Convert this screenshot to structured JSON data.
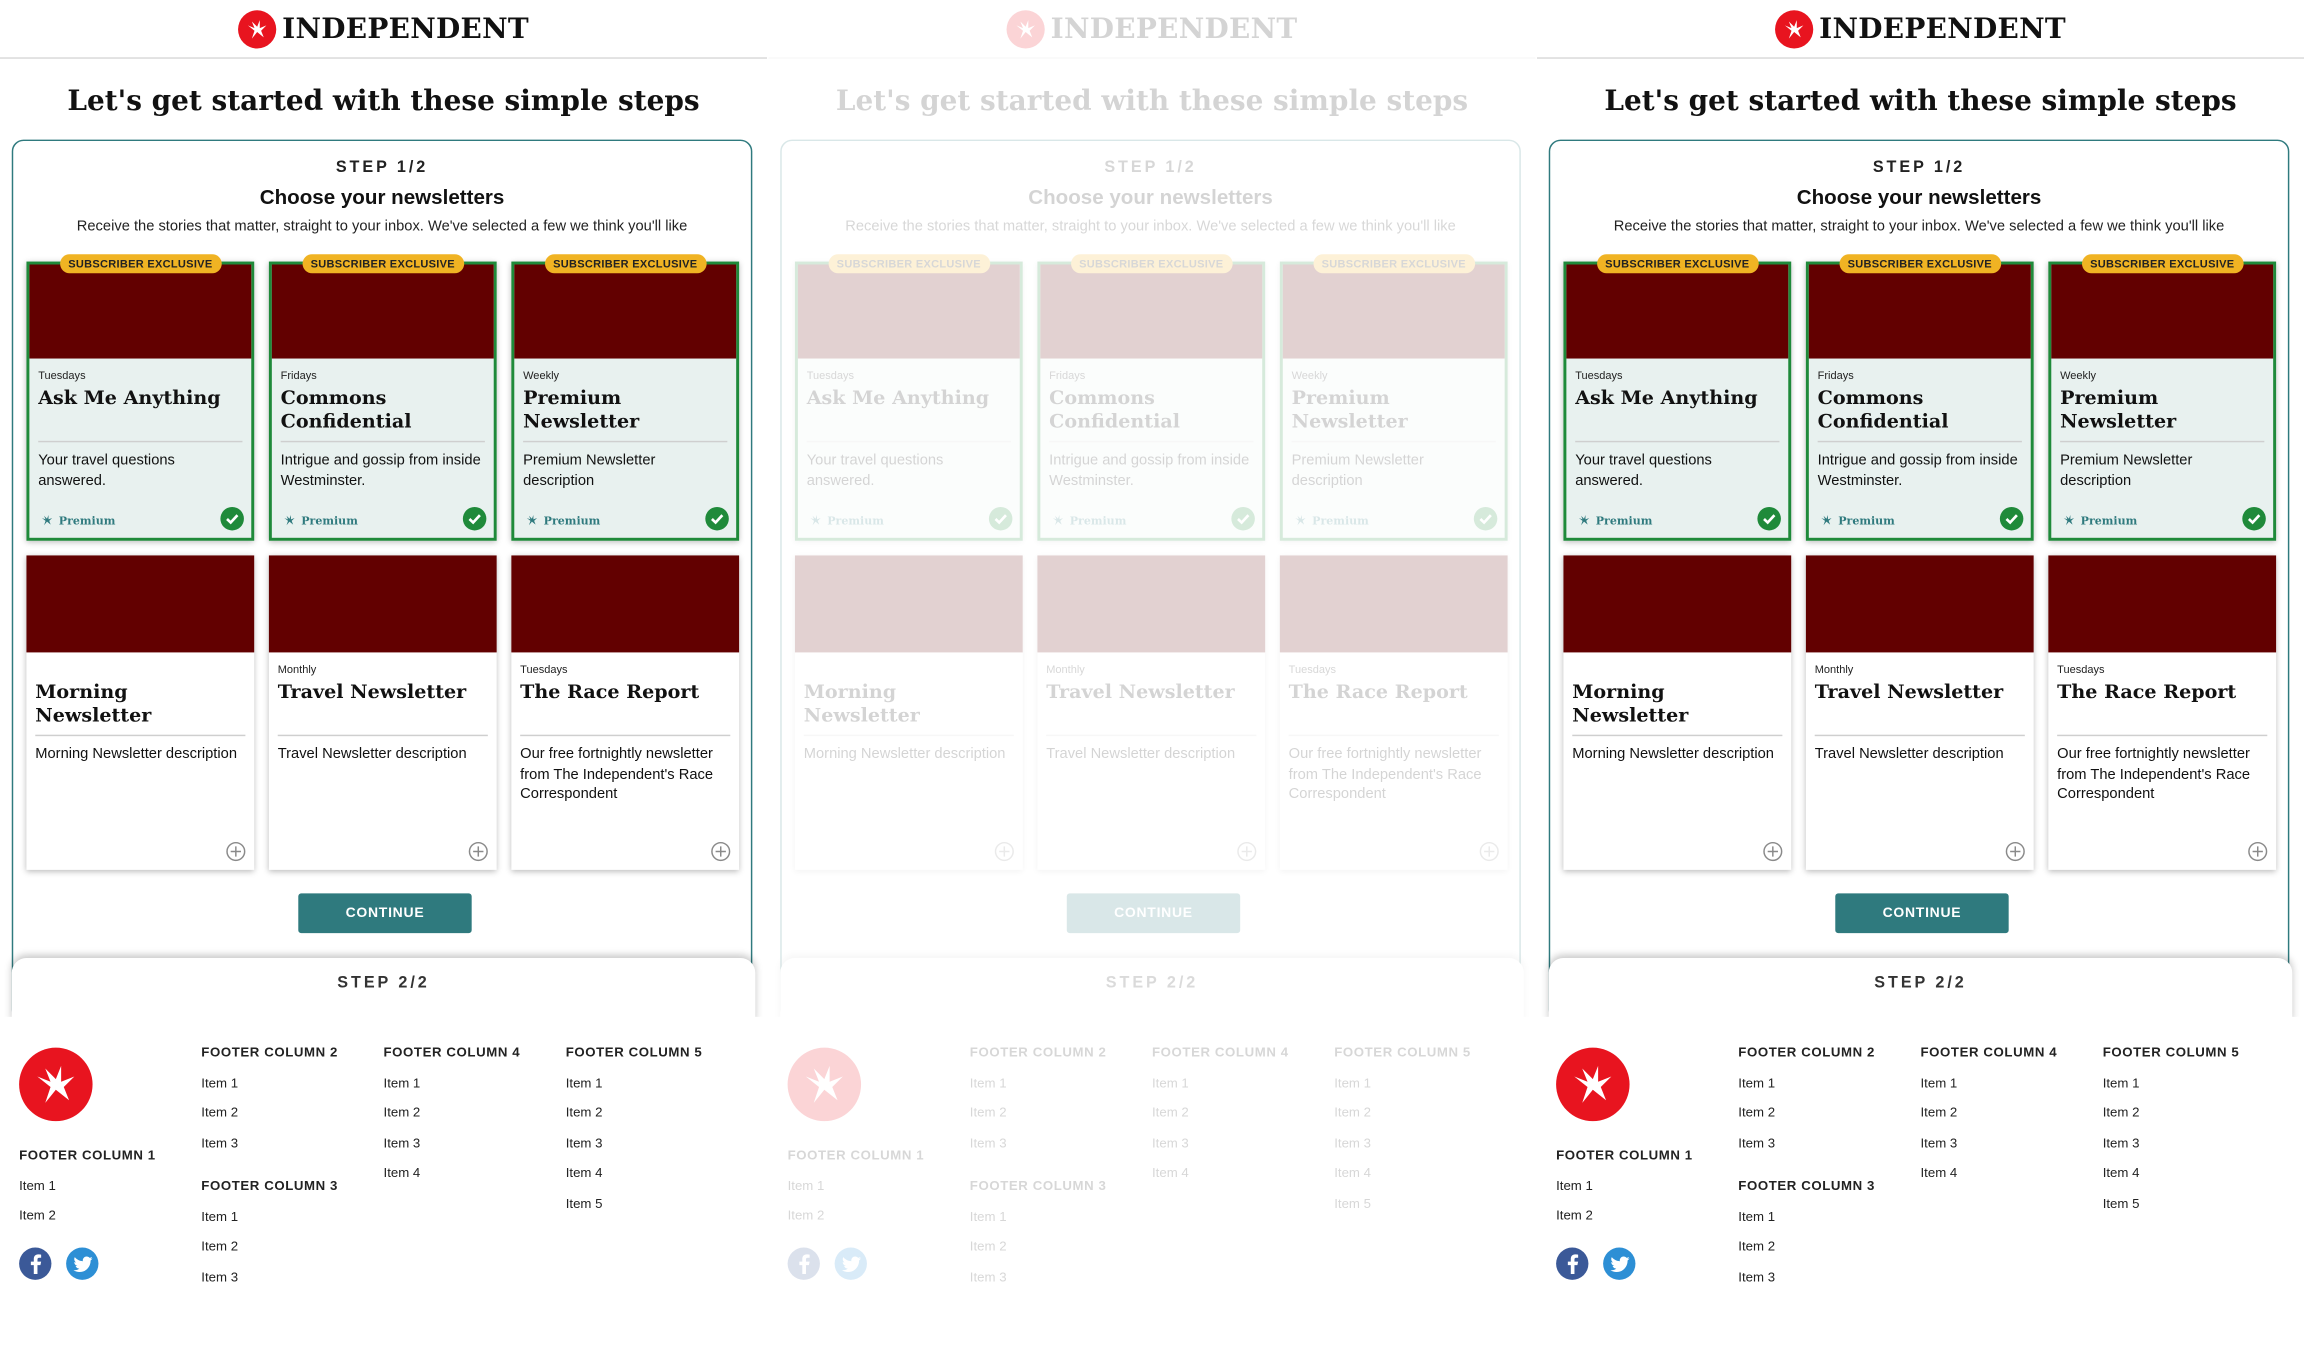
{
  "brand": {
    "name": "INDEPENDENT",
    "logo_icon": "eagle-logo-icon",
    "accent": "#e8141f"
  },
  "page": {
    "title": "Let's get started with these simple steps"
  },
  "step1": {
    "label": "STEP 1/2",
    "heading": "Choose your newsletters",
    "subtitle": "Receive the stories that matter, straight to your inbox. We've selected a few we think you'll like"
  },
  "cards": [
    {
      "badge": "SUBSCRIBER EXCLUSIVE",
      "frequency": "Tuesdays",
      "title": "Ask Me Anything",
      "description": "Your travel questions answered.",
      "premium_label": "Premium",
      "selected": true
    },
    {
      "badge": "SUBSCRIBER EXCLUSIVE",
      "frequency": "Fridays",
      "title": "Commons Confidential",
      "description": "Intrigue and gossip from inside Westminster.",
      "premium_label": "Premium",
      "selected": true
    },
    {
      "badge": "SUBSCRIBER EXCLUSIVE",
      "frequency": "Weekly",
      "title": "Premium Newsletter",
      "description": "Premium Newsletter description",
      "premium_label": "Premium",
      "selected": true
    },
    {
      "badge": "",
      "frequency": "",
      "title": "Morning Newsletter",
      "description": "Morning Newsletter description",
      "premium_label": "",
      "selected": false
    },
    {
      "badge": "",
      "frequency": "Monthly",
      "title": "Travel Newsletter",
      "description": "Travel Newsletter description",
      "premium_label": "",
      "selected": false
    },
    {
      "badge": "",
      "frequency": "Tuesdays",
      "title": "The Race Report",
      "description": "Our free fortnightly newsletter from The Independent's Race Correspondent",
      "premium_label": "",
      "selected": false
    }
  ],
  "continue_label": "CONTINUE",
  "step2": {
    "label": "STEP 2/2"
  },
  "footer": {
    "columns": [
      {
        "heading": "FOOTER COLUMN 1",
        "items": [
          "Item 1",
          "Item 2"
        ]
      },
      {
        "heading": "FOOTER COLUMN 2",
        "items": [
          "Item 1",
          "Item 2",
          "Item 3"
        ]
      },
      {
        "heading": "FOOTER COLUMN 3",
        "items": [
          "Item 1",
          "Item 2",
          "Item 3"
        ]
      },
      {
        "heading": "FOOTER COLUMN 4",
        "items": [
          "Item 1",
          "Item 2",
          "Item 3",
          "Item 4"
        ]
      },
      {
        "heading": "FOOTER COLUMN 5",
        "items": [
          "Item 1",
          "Item 2",
          "Item 3",
          "Item 4",
          "Item 5"
        ]
      }
    ],
    "social": [
      "facebook-icon",
      "twitter-icon"
    ]
  },
  "colors": {
    "teal": "#2f7a7e",
    "card_image": "#620000",
    "badge": "#f0b323",
    "check": "#1f8a3a",
    "facebook": "#3b5998",
    "twitter": "#2d8fd5"
  }
}
